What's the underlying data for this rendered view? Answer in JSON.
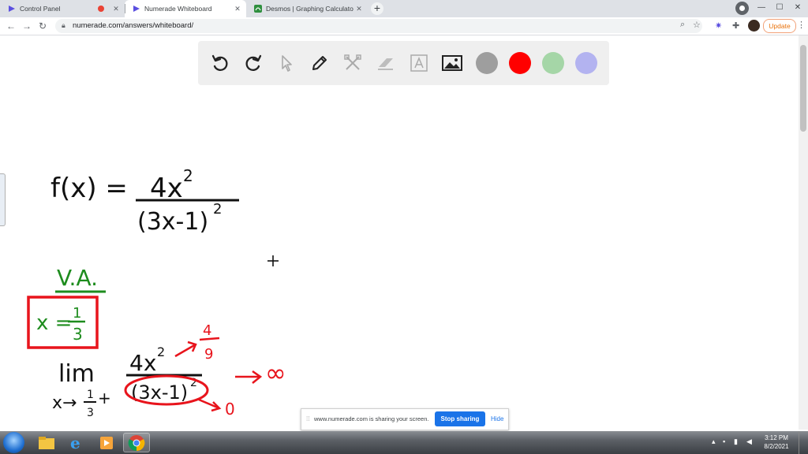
{
  "browser": {
    "tabs": [
      {
        "title": "Control Panel",
        "recording": true
      },
      {
        "title": "Numerade Whiteboard",
        "active": true
      },
      {
        "title": "Desmos | Graphing Calculator"
      }
    ],
    "url": "numerade.com/answers/whiteboard/",
    "update_label": "Update",
    "new_tab": "+",
    "back": "←",
    "forward": "→",
    "reload": "↻",
    "minimize": "—",
    "maximize": "☐",
    "close": "✕"
  },
  "toolbar": {
    "tools": [
      "undo-icon",
      "redo-icon",
      "pointer-icon",
      "pen-icon",
      "tools-icon",
      "eraser-icon",
      "text-icon",
      "image-icon"
    ],
    "colors": [
      "#9e9e9e",
      "#ff0000",
      "#a5d6a7",
      "#b3b3f0"
    ]
  },
  "whiteboard": {
    "fx": "f(x) =",
    "numerator": "4x",
    "numerator_exp": "2",
    "denominator": "(3x-1)",
    "denominator_exp": "2",
    "va_label": "V.A.",
    "va_x": "x =",
    "va_num": "1",
    "va_den": "3",
    "lim": "lim",
    "lim_sub": "x→",
    "lim_sub_num": "1",
    "lim_sub_den": "3",
    "lim_sub_sign": "+",
    "lim_num": "4x",
    "lim_num_exp": "2",
    "lim_den": "(3x-1)",
    "lim_den_exp": "2",
    "num_limit_num": "4",
    "num_limit_den": "9",
    "den_limit": "0",
    "result": "∞",
    "colors": {
      "ink": "#111111",
      "green": "#1e8c1e",
      "red": "#e8141c"
    }
  },
  "share_bar": {
    "text": "www.numerade.com is sharing your screen.",
    "stop": "Stop sharing",
    "hide": "Hide"
  },
  "taskbar": {
    "time": "3:12 PM",
    "date": "8/2/2021"
  }
}
